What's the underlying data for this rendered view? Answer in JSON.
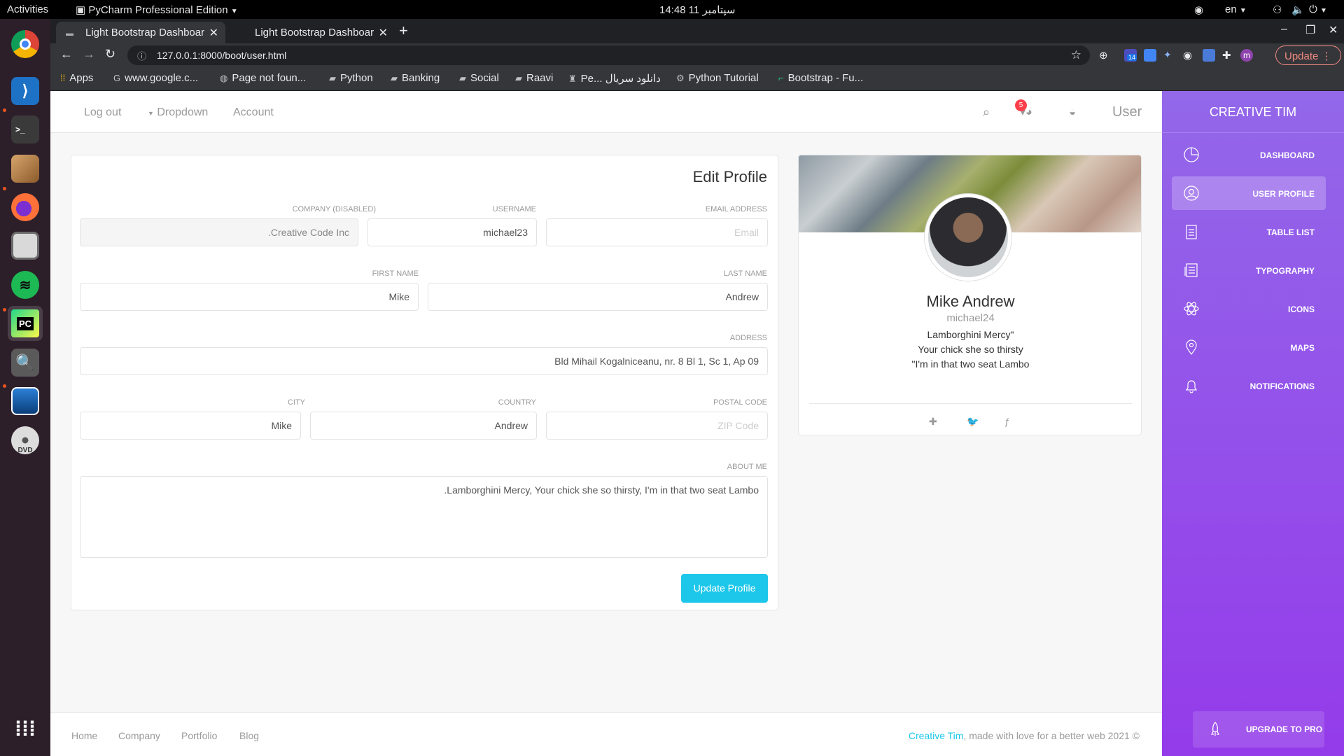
{
  "topbar": {
    "activities": "Activities",
    "app_menu": "PyCharm Professional Edition",
    "clock": "14:48  11 سپتامبر",
    "lang": "en"
  },
  "browser": {
    "tabs": [
      {
        "title": "Light Bootstrap Dashboard"
      },
      {
        "title": "Light Bootstrap Dashboard"
      }
    ],
    "url": "127.0.0.1:8000/boot/user.html",
    "update_label": "Update",
    "ext_badge": "14",
    "profile_initial": "m",
    "bookmarks": [
      "Apps",
      "www.google.c...",
      "Page not foun...",
      "Python",
      "Banking",
      "Social",
      "Raavi",
      "Pe... دانلود سریال",
      "Python Tutorial",
      "Bootstrap - Fu..."
    ]
  },
  "navbar": {
    "logout": "Log out",
    "dropdown": "Dropdown",
    "account": "Account",
    "user": "User",
    "notif_count": "5"
  },
  "edit_profile": {
    "title": "Edit Profile",
    "company": {
      "label": "Company (disabled)",
      "value": ".Creative Code Inc"
    },
    "username": {
      "label": "Username",
      "value": "michael23"
    },
    "email": {
      "label": "Email address",
      "placeholder": "Email"
    },
    "first_name": {
      "label": "First Name",
      "value": "Mike"
    },
    "last_name": {
      "label": "Last Name",
      "value": "Andrew"
    },
    "address": {
      "label": "Address",
      "value": "Bld Mihail Kogalniceanu, nr. 8 Bl 1, Sc 1, Ap 09"
    },
    "city": {
      "label": "City",
      "value": "Mike"
    },
    "country": {
      "label": "Country",
      "value": "Andrew"
    },
    "postal": {
      "label": "Postal Code",
      "placeholder": "ZIP Code"
    },
    "about": {
      "label": "About Me",
      "value": ".Lamborghini Mercy, Your chick she so thirsty, I'm in that two seat Lambo"
    },
    "submit": "Update Profile"
  },
  "user_card": {
    "name": "Mike Andrew",
    "username": "michael24",
    "bio": [
      "Lamborghini Mercy\"",
      "Your chick she so thirsty",
      "\"I'm in that two seat Lambo"
    ]
  },
  "sidebar": {
    "brand": "Creative Tim",
    "items": [
      {
        "label": "Dashboard"
      },
      {
        "label": "User Profile"
      },
      {
        "label": "Table List"
      },
      {
        "label": "Typography"
      },
      {
        "label": "Icons"
      },
      {
        "label": "Maps"
      },
      {
        "label": "Notifications"
      }
    ],
    "upgrade": "Upgrade to PRO"
  },
  "footer": {
    "links": [
      "Home",
      "Company",
      "Portfolio",
      "Blog"
    ],
    "brand": "Creative Tim",
    "copyright": ", made with love for a better web 2021 ©"
  },
  "colors": {
    "accent": "#1dc7ea",
    "sidebar_top": "#9368e9",
    "sidebar_bottom": "#943bea",
    "badge": "#fb404b"
  }
}
